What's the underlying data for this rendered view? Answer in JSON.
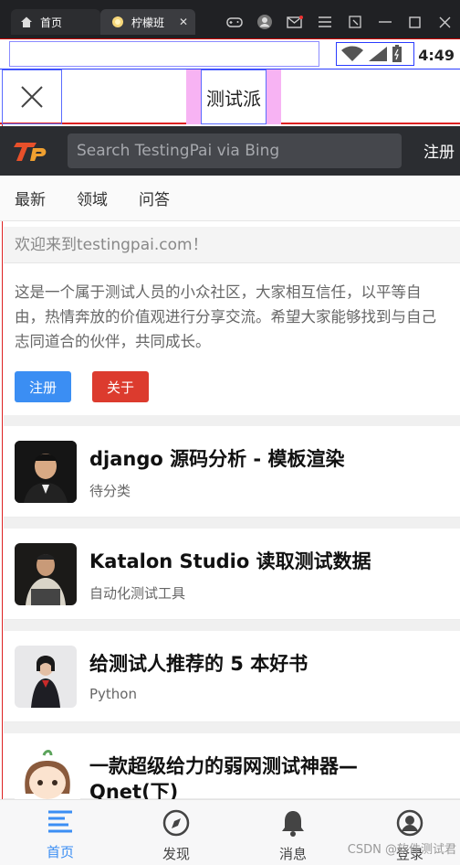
{
  "window": {
    "tabs": [
      {
        "label": "首页",
        "icon": "home-icon"
      },
      {
        "label": "柠檬班",
        "icon": "lemon-icon",
        "close": "✕"
      }
    ]
  },
  "status": {
    "time": "4:49"
  },
  "appbar": {
    "title": "测试派",
    "close_icon": "close-icon"
  },
  "header": {
    "search_placeholder": "Search TestingPai via Bing",
    "register": "注册"
  },
  "nav": {
    "tabs": [
      "最新",
      "领域",
      "问答"
    ]
  },
  "welcome": {
    "title": "欢迎来到testingpai.com！",
    "body": "这是一个属于测试人员的小众社区，大家相互信任，以平等自由，热情奔放的价值观进行分享交流。希望大家能够找到与自己志同道合的伙伴，共同成长。",
    "register_label": "注册",
    "about_label": "关于"
  },
  "feed": [
    {
      "title": "django 源码分析 - 模板渲染",
      "category": "待分类"
    },
    {
      "title": "Katalon Studio 读取测试数据",
      "category": "自动化测试工具"
    },
    {
      "title": "给测试人推荐的 5 本好书",
      "category": "Python"
    },
    {
      "title": "一款超级给力的弱网测试神器—",
      "title2": "Qnet(下)",
      "category": ""
    }
  ],
  "bottom_nav": [
    {
      "label": "首页",
      "icon": "list-icon",
      "active": true
    },
    {
      "label": "发现",
      "icon": "compass-icon"
    },
    {
      "label": "消息",
      "icon": "bell-icon"
    },
    {
      "label": "登录",
      "icon": "user-icon"
    }
  ],
  "watermark": "CSDN @软件测试君",
  "colors": {
    "accent": "#3b8ef3",
    "danger": "#dc3b2e",
    "header": "#2b2d31"
  }
}
